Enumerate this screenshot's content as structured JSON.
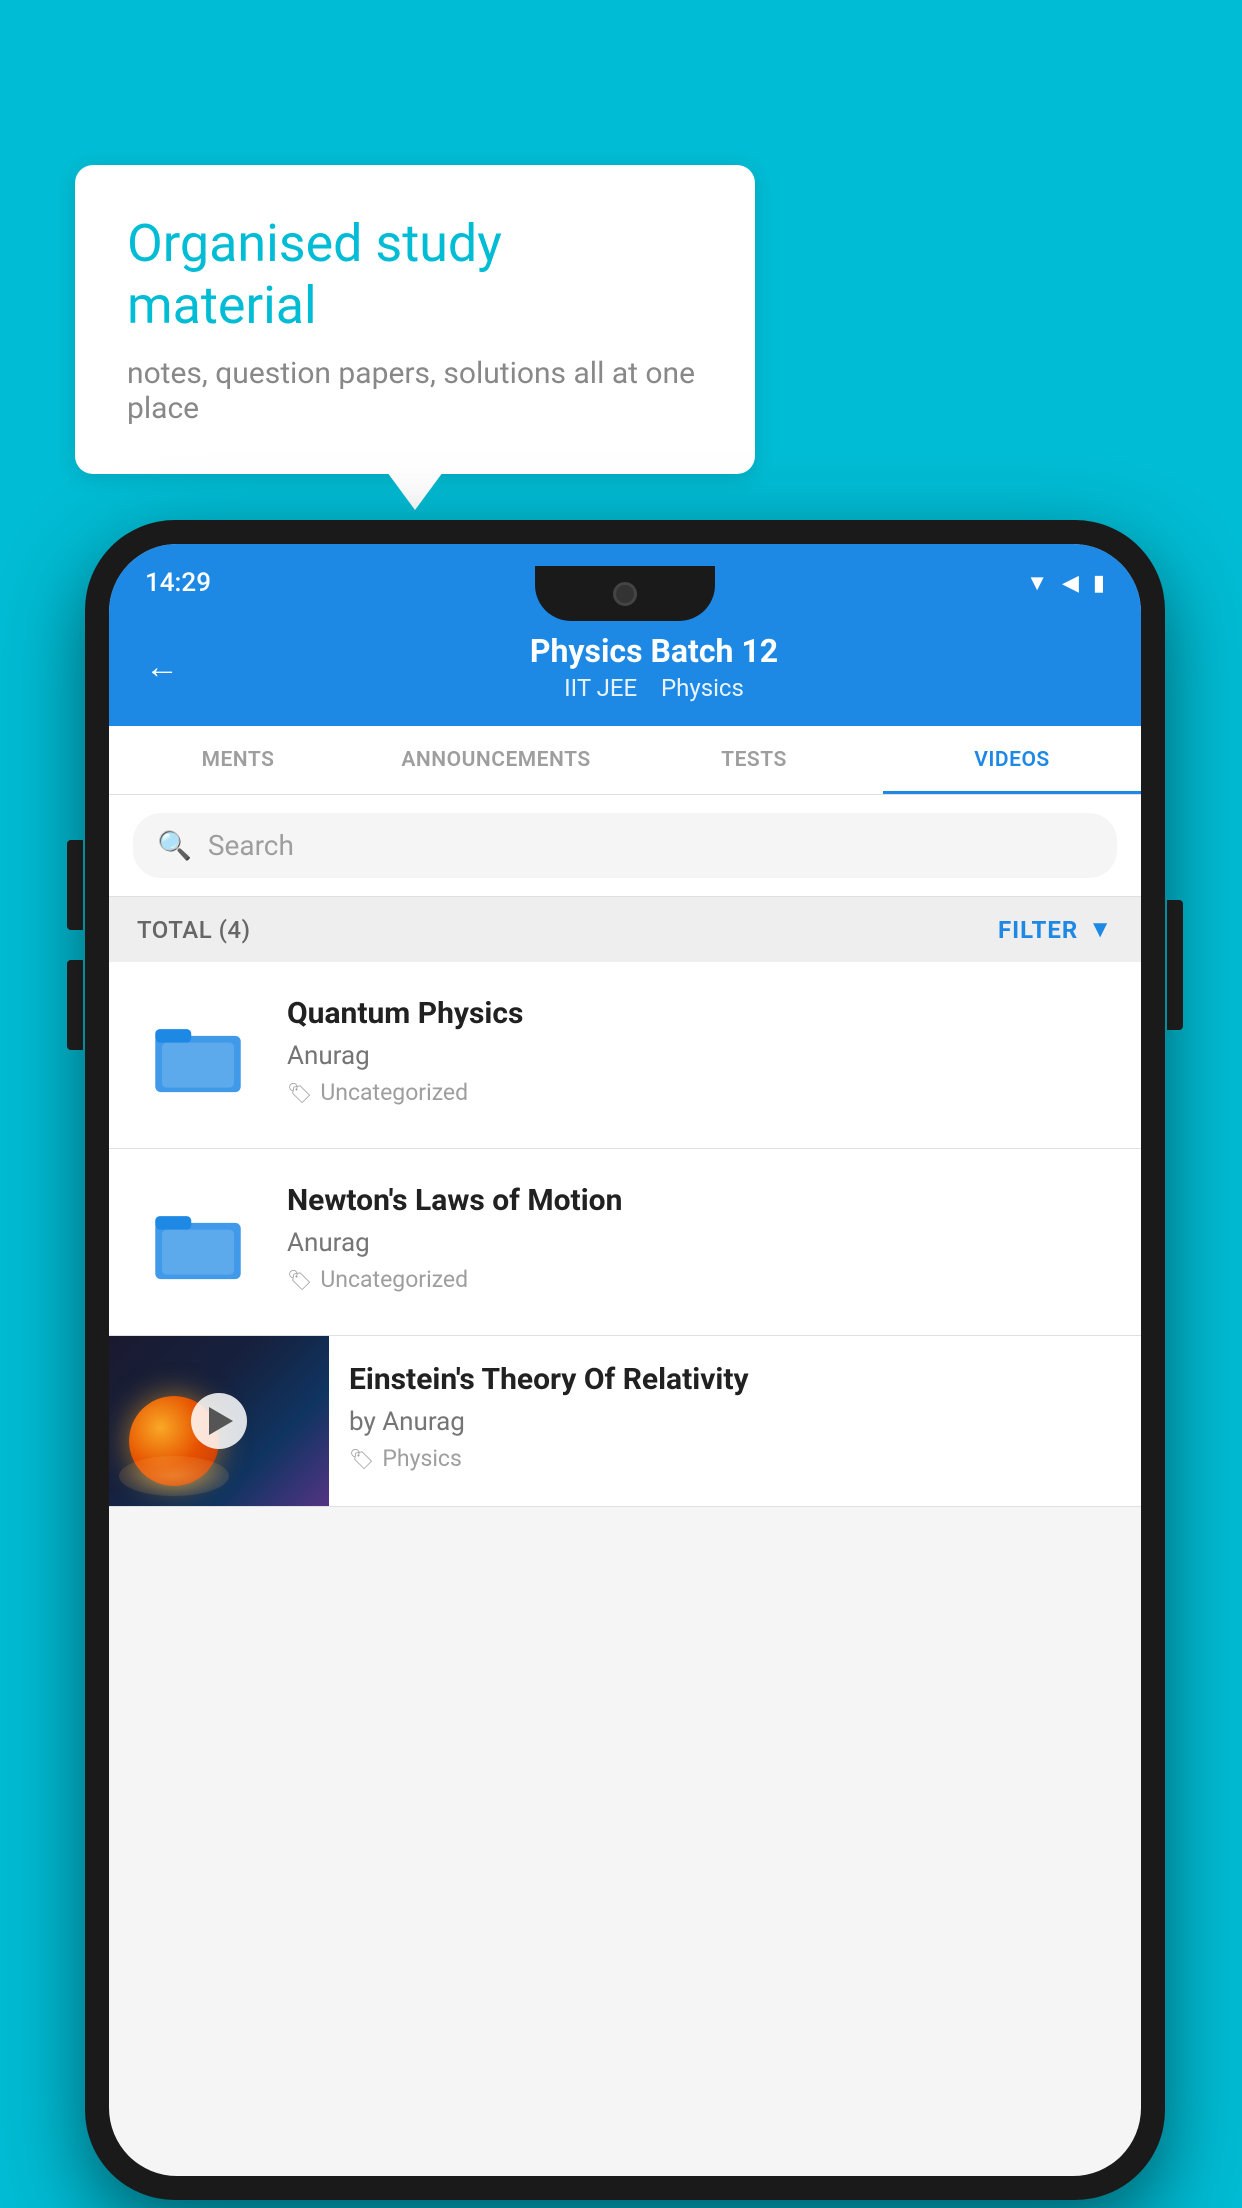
{
  "background": {
    "color": "#00BCD4"
  },
  "speech_bubble": {
    "title": "Organised study material",
    "subtitle": "notes, question papers, solutions all at one place"
  },
  "phone": {
    "status_bar": {
      "time": "14:29"
    },
    "header": {
      "back_label": "←",
      "title": "Physics Batch 12",
      "subtitle_part1": "IIT JEE",
      "subtitle_part2": "Physics"
    },
    "tabs": [
      {
        "label": "MENTS",
        "active": false
      },
      {
        "label": "ANNOUNCEMENTS",
        "active": false
      },
      {
        "label": "TESTS",
        "active": false
      },
      {
        "label": "VIDEOS",
        "active": true
      }
    ],
    "search": {
      "placeholder": "Search"
    },
    "filter": {
      "total_label": "TOTAL (4)",
      "filter_label": "FILTER"
    },
    "videos": [
      {
        "id": 1,
        "title": "Quantum Physics",
        "author": "Anurag",
        "tag": "Uncategorized",
        "has_thumbnail": false
      },
      {
        "id": 2,
        "title": "Newton's Laws of Motion",
        "author": "Anurag",
        "tag": "Uncategorized",
        "has_thumbnail": false
      },
      {
        "id": 3,
        "title": "Einstein's Theory Of Relativity",
        "author": "by Anurag",
        "tag": "Physics",
        "has_thumbnail": true
      }
    ]
  }
}
